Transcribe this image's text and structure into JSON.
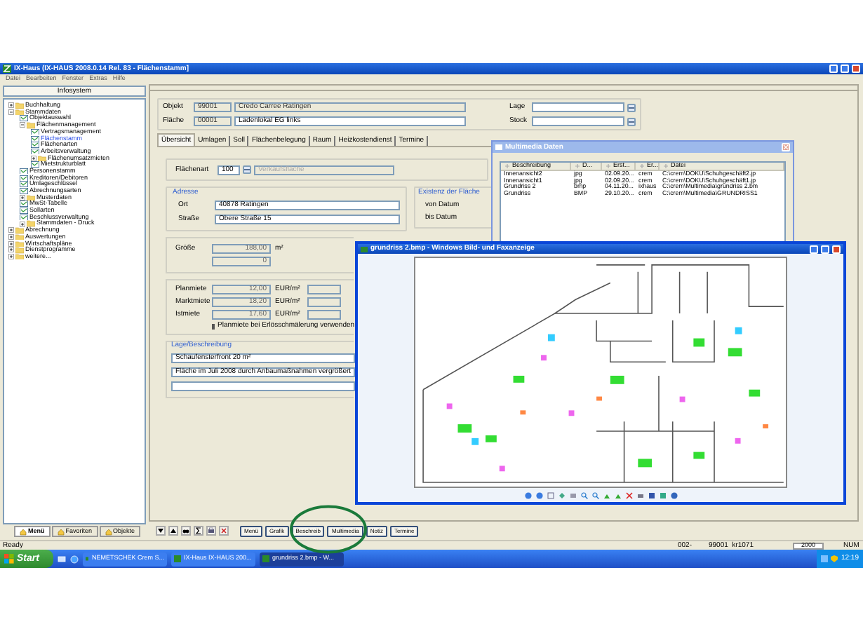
{
  "window": {
    "title": "IX-Haus (IX-HAUS 2008.0.14 Rel. 83 - Flächenstamm]"
  },
  "menu": [
    "Datei",
    "Bearbeiten",
    "Fenster",
    "Extras",
    "Hilfe"
  ],
  "sidebar": {
    "header": "Infosystem",
    "tree": [
      {
        "label": "Buchhaltung",
        "kind": "folder",
        "expanded": false,
        "selected": false
      },
      {
        "label": "Stammdaten",
        "kind": "folder",
        "expanded": true,
        "selected": false,
        "children": [
          {
            "label": "Objektauswahl",
            "kind": "form",
            "selected": false
          },
          {
            "label": "Flächenmanagement",
            "kind": "folder",
            "expanded": true,
            "selected": false,
            "children": [
              {
                "label": "Vertragsmanagement",
                "kind": "form",
                "selected": false
              },
              {
                "label": "Flächenstamm",
                "kind": "form",
                "selected": true
              },
              {
                "label": "Flächenarten",
                "kind": "form",
                "selected": false
              },
              {
                "label": "Arbeitsverwaltung",
                "kind": "form",
                "selected": false
              },
              {
                "label": "Flächenumsatzmieten",
                "kind": "folder",
                "expanded": false,
                "selected": false
              },
              {
                "label": "Mietstrukturblatt",
                "kind": "form",
                "selected": false
              }
            ]
          },
          {
            "label": "Personenstamm",
            "kind": "form",
            "selected": false
          },
          {
            "label": "Kreditoren/Debitoren",
            "kind": "form",
            "selected": false
          },
          {
            "label": "Umlageschlüssel",
            "kind": "form",
            "selected": false
          },
          {
            "label": "Abrechnungsarten",
            "kind": "form",
            "selected": false
          },
          {
            "label": "Musterdaten",
            "kind": "folder",
            "expanded": false,
            "selected": false
          },
          {
            "label": "MwSt-Tabelle",
            "kind": "form",
            "selected": false
          },
          {
            "label": "Sollarten",
            "kind": "form",
            "selected": false
          },
          {
            "label": "Beschlussverwaltung",
            "kind": "form",
            "selected": false
          },
          {
            "label": "Stammdaten - Druck",
            "kind": "folder",
            "expanded": false,
            "selected": false
          }
        ]
      },
      {
        "label": "Abrechnung",
        "kind": "folder",
        "expanded": false,
        "selected": false
      },
      {
        "label": "Auswertungen",
        "kind": "folder",
        "expanded": false,
        "selected": false
      },
      {
        "label": "Wirtschaftspläne",
        "kind": "folder",
        "expanded": false,
        "selected": false
      },
      {
        "label": "Dienstprogramme",
        "kind": "folder",
        "expanded": false,
        "selected": false
      },
      {
        "label": "weitere...",
        "kind": "folder",
        "expanded": false,
        "selected": false
      }
    ],
    "tabs": [
      {
        "label": "Menü",
        "selected": true
      },
      {
        "label": "Favoriten",
        "selected": false
      },
      {
        "label": "Objekte",
        "selected": false
      }
    ]
  },
  "header": {
    "fields": [
      {
        "label": "Objekt",
        "code": "99001",
        "name": "Credo Carree Ratingen",
        "disabled": true
      },
      {
        "label": "Fläche",
        "code": "00001",
        "name": "Ladenlokal EG links",
        "disabled": false
      }
    ],
    "lookups": [
      "Lage",
      "Stock"
    ]
  },
  "tabs": [
    {
      "label": "Übersicht",
      "selected": true
    },
    {
      "label": "Umlagen",
      "selected": false
    },
    {
      "label": "Soll",
      "selected": false
    },
    {
      "label": "Flächenbelegung",
      "selected": false
    },
    {
      "label": "Raum",
      "selected": false
    },
    {
      "label": "Heizkostendienst",
      "selected": false
    },
    {
      "label": "Termine",
      "selected": false
    }
  ],
  "area_type": {
    "label": "Flächenart",
    "code": "100",
    "name": "Verkaufsfläche"
  },
  "address": {
    "title": "Adresse",
    "fields": [
      {
        "label": "Ort",
        "value": "40878 Ratingen"
      },
      {
        "label": "Straße",
        "value": "Obere Straße 15"
      }
    ]
  },
  "existence": {
    "title": "Existenz der Fläche",
    "fields": [
      "von Datum",
      "bis Datum"
    ]
  },
  "size": {
    "label": "Größe",
    "value": "188,00",
    "unit": "m²",
    "value_2": "0"
  },
  "rents": {
    "rows": [
      {
        "label": "Planmiete",
        "value": "12,00",
        "unit": "EUR/m²"
      },
      {
        "label": "Marktmiete",
        "value": "18,20",
        "unit": "EUR/m²"
      },
      {
        "label": "Istmiete",
        "value": "17,60",
        "unit": "EUR/m²"
      }
    ],
    "checkbox": {
      "label": "Planmiete bei Erlösschmälerung verwenden",
      "checked": false
    }
  },
  "description": {
    "title": "Lage/Beschreibung",
    "lines": [
      "Schaufensterfront 20 m²",
      "Fläche im Juli 2008 durch Anbaumaßnahmen vergrößert"
    ]
  },
  "toolbar_buttons": [
    "Menü",
    "Grafik",
    "Beschreib",
    "Multimedia",
    "Notiz",
    "Termine"
  ],
  "status_bar": {
    "text": "Ready",
    "fields": [
      "002-",
      "99001  kr1071",
      "2000",
      "NUM"
    ]
  },
  "taskbar": {
    "start": "Start",
    "tasks": [
      {
        "label": "NEMETSCHEK Crem S...",
        "selected": false
      },
      {
        "label": "IX-Haus IX-HAUS 200...",
        "selected": false
      },
      {
        "label": "grundriss 2.bmp - W...",
        "selected": true
      }
    ],
    "clock": "12:19"
  },
  "multimedia_window": {
    "title": "Multimedia Daten",
    "columns": [
      "Beschreibung",
      "D...",
      "Erst...",
      "Er...",
      "Datei"
    ],
    "rows": [
      [
        "Innenansicht2",
        "jpg",
        "02.09.20...",
        "crem",
        "C:\\crem\\DOKU\\Schuhgeschäft2.jp"
      ],
      [
        "Innenansicht1",
        "jpg",
        "02.09.20...",
        "crem",
        "C:\\crem\\DOKU\\Schuhgeschäft1.jp"
      ],
      [
        "Grundriss 2",
        "bmp",
        "04.11.20...",
        "ixhaus",
        "C:\\crem\\Multimedia\\grundriss 2.bm"
      ],
      [
        "Grundriss",
        "BMP",
        "29.10.20...",
        "crem",
        "C:\\crem\\Multimedia\\GRUNDRISS1"
      ]
    ]
  },
  "viewer_window": {
    "title": "grundriss 2.bmp - Windows Bild- und Faxanzeige"
  }
}
